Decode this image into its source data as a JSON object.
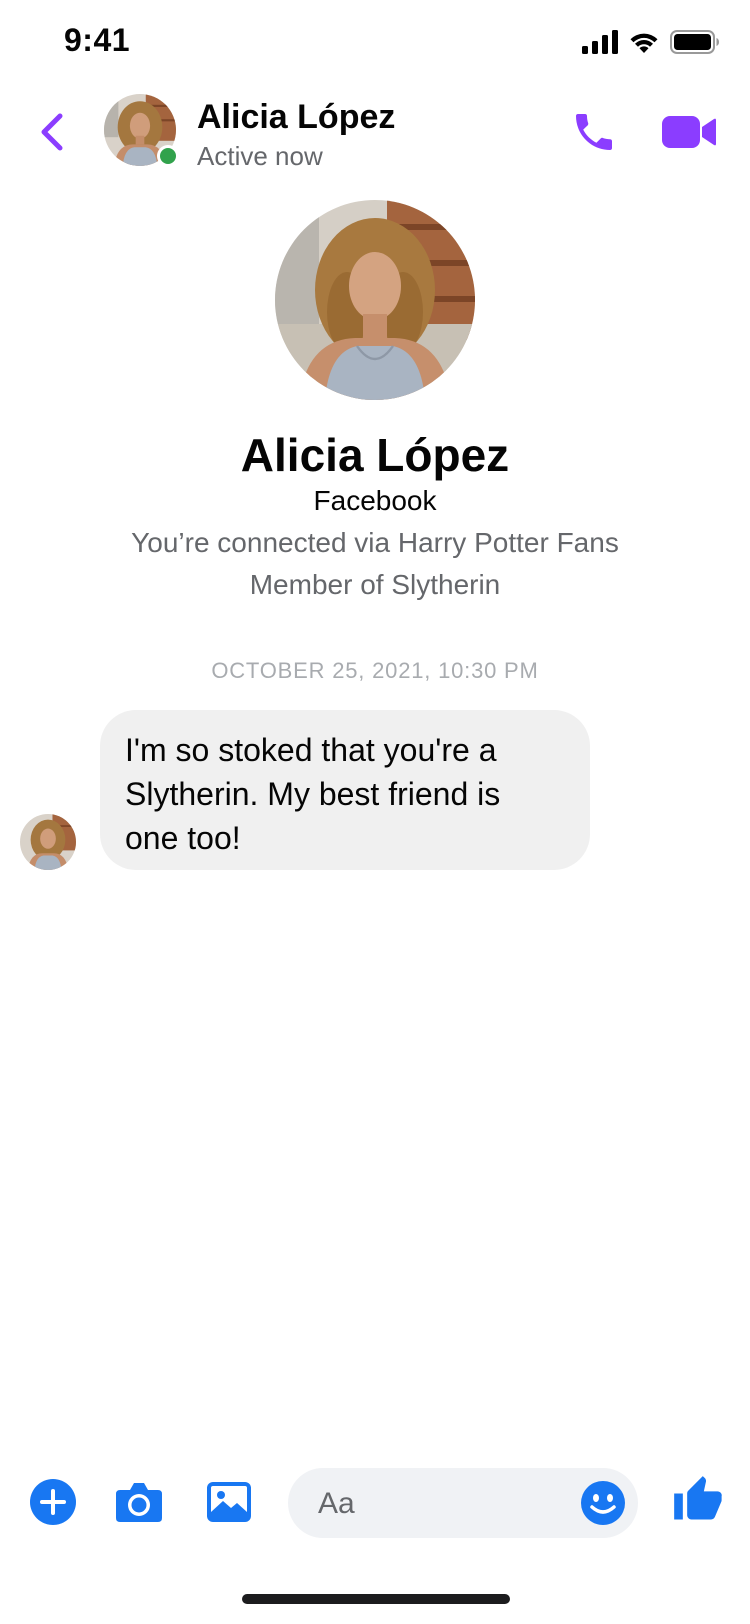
{
  "status_bar": {
    "time": "9:41",
    "icons": [
      "signal-icon",
      "wifi-icon",
      "battery-icon"
    ]
  },
  "header": {
    "back_icon": "chevron-left-icon",
    "name": "Alicia López",
    "status": "Active now",
    "call_icon": "phone-icon",
    "video_icon": "video-camera-icon",
    "accent_color": "#8b3dff",
    "online_color": "#31a24c"
  },
  "profile": {
    "name": "Alicia López",
    "platform": "Facebook",
    "connection": "You’re connected via Harry Potter Fans",
    "membership": "Member of Slytherin"
  },
  "conversation": {
    "timestamp": "OCTOBER 25, 2021, 10:30 PM",
    "messages": [
      {
        "sender": "Alicia López",
        "text": "I'm so stoked that you're a Slytherin. My best friend is one too!"
      }
    ]
  },
  "composer": {
    "placeholder": "Aa",
    "icons": [
      "plus-circle-icon",
      "camera-icon",
      "photo-gallery-icon",
      "emoji-icon",
      "thumbs-up-icon"
    ],
    "accent_color": "#1877f2"
  }
}
